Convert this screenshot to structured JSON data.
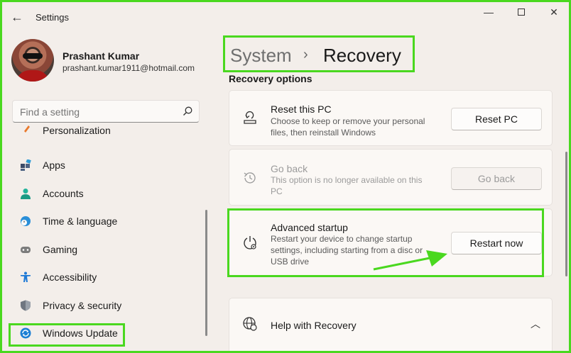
{
  "titlebar": {
    "app_title": "Settings",
    "back_glyph": "←",
    "minimize_glyph": "—",
    "close_glyph": "✕"
  },
  "user": {
    "name": "Prashant Kumar",
    "email": "prashant.kumar1911@hotmail.com"
  },
  "search": {
    "placeholder": "Find a setting"
  },
  "sidebar": {
    "items": [
      {
        "label": "Personalization",
        "icon": "brush-icon",
        "color": "#e9792c"
      },
      {
        "label": "Apps",
        "icon": "apps-icon",
        "color": "#3a4a66"
      },
      {
        "label": "Accounts",
        "icon": "person-icon",
        "color": "#22b39b"
      },
      {
        "label": "Time & language",
        "icon": "globe-clock-icon",
        "color": "#2a8fd8"
      },
      {
        "label": "Gaming",
        "icon": "gamepad-icon",
        "color": "#7c7c7c"
      },
      {
        "label": "Accessibility",
        "icon": "accessibility-icon",
        "color": "#1f7ad6"
      },
      {
        "label": "Privacy & security",
        "icon": "shield-icon",
        "color": "#6f7680"
      },
      {
        "label": "Windows Update",
        "icon": "update-icon",
        "color": "#1c7fd4"
      }
    ]
  },
  "breadcrumb": {
    "parent": "System",
    "separator": "›",
    "current": "Recovery"
  },
  "section_title": "Recovery options",
  "cards": {
    "reset": {
      "title": "Reset this PC",
      "desc": "Choose to keep or remove your personal files, then reinstall Windows",
      "button": "Reset PC"
    },
    "goback": {
      "title": "Go back",
      "desc": "This option is no longer available on this PC",
      "button": "Go back"
    },
    "advanced": {
      "title": "Advanced startup",
      "desc": "Restart your device to change startup settings, including starting from a disc or USB drive",
      "button": "Restart now"
    },
    "help": {
      "title": "Help with Recovery",
      "chevron": "︿"
    }
  },
  "colors": {
    "highlight": "#4ad81f",
    "background": "#f3eeea"
  }
}
